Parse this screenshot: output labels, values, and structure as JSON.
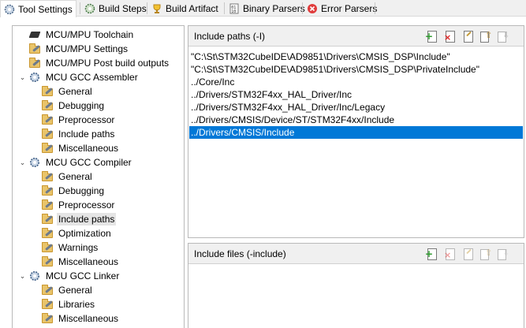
{
  "tabs": [
    {
      "label": "Tool Settings",
      "icon": "tool-settings-icon",
      "active": true
    },
    {
      "label": "Build Steps",
      "icon": "build-steps-icon"
    },
    {
      "label": "Build Artifact",
      "icon": "build-artifact-icon"
    },
    {
      "label": "Binary Parsers",
      "icon": "binary-parsers-icon"
    },
    {
      "label": "Error Parsers",
      "icon": "error-parsers-icon"
    }
  ],
  "tree": [
    {
      "label": "MCU/MPU Toolchain",
      "level": 0,
      "icon": "chip-icon"
    },
    {
      "label": "MCU/MPU Settings",
      "level": 0,
      "icon": "folder-settings-icon"
    },
    {
      "label": "MCU/MPU Post build outputs",
      "level": 0,
      "icon": "folder-settings-icon"
    },
    {
      "label": "MCU GCC Assembler",
      "level": 0,
      "icon": "gear-icon",
      "expander": "⌄"
    },
    {
      "label": "General",
      "level": 1,
      "icon": "folder-settings-icon"
    },
    {
      "label": "Debugging",
      "level": 1,
      "icon": "folder-settings-icon"
    },
    {
      "label": "Preprocessor",
      "level": 1,
      "icon": "folder-settings-icon"
    },
    {
      "label": "Include paths",
      "level": 1,
      "icon": "folder-settings-icon"
    },
    {
      "label": "Miscellaneous",
      "level": 1,
      "icon": "folder-settings-icon"
    },
    {
      "label": "MCU GCC Compiler",
      "level": 0,
      "icon": "gear-icon",
      "expander": "⌄"
    },
    {
      "label": "General",
      "level": 1,
      "icon": "folder-settings-icon"
    },
    {
      "label": "Debugging",
      "level": 1,
      "icon": "folder-settings-icon"
    },
    {
      "label": "Preprocessor",
      "level": 1,
      "icon": "folder-settings-icon"
    },
    {
      "label": "Include paths",
      "level": 1,
      "icon": "folder-settings-icon",
      "selected": true
    },
    {
      "label": "Optimization",
      "level": 1,
      "icon": "folder-settings-icon"
    },
    {
      "label": "Warnings",
      "level": 1,
      "icon": "folder-settings-icon"
    },
    {
      "label": "Miscellaneous",
      "level": 1,
      "icon": "folder-settings-icon"
    },
    {
      "label": "MCU GCC Linker",
      "level": 0,
      "icon": "gear-icon",
      "expander": "⌄"
    },
    {
      "label": "General",
      "level": 1,
      "icon": "folder-settings-icon"
    },
    {
      "label": "Libraries",
      "level": 1,
      "icon": "folder-settings-icon"
    },
    {
      "label": "Miscellaneous",
      "level": 1,
      "icon": "folder-settings-icon"
    }
  ],
  "include_paths": {
    "title": "Include paths (-I)",
    "tools": [
      "add-icon",
      "delete-icon",
      "edit-icon",
      "move-up-icon",
      "move-down-icon"
    ],
    "items": [
      "\"C:\\St\\STM32CubeIDE\\AD9851\\Drivers\\CMSIS_DSP\\Include\"",
      "\"C:\\St\\STM32CubeIDE\\AD9851\\Drivers\\CMSIS_DSP\\PrivateInclude\"",
      "../Core/Inc",
      "../Drivers/STM32F4xx_HAL_Driver/Inc",
      "../Drivers/STM32F4xx_HAL_Driver/Inc/Legacy",
      "../Drivers/CMSIS/Device/ST/STM32F4xx/Include",
      "../Drivers/CMSIS/Include"
    ],
    "selected_index": 6
  },
  "include_files": {
    "title": "Include files (-include)",
    "tools": [
      "add-icon",
      "delete-icon",
      "edit-icon",
      "move-up-icon",
      "move-down-icon"
    ],
    "items": []
  },
  "colors": {
    "selection": "#0078d7",
    "tree_selection": "#e5e5e5",
    "tab_bg": "#f0f0f0"
  }
}
